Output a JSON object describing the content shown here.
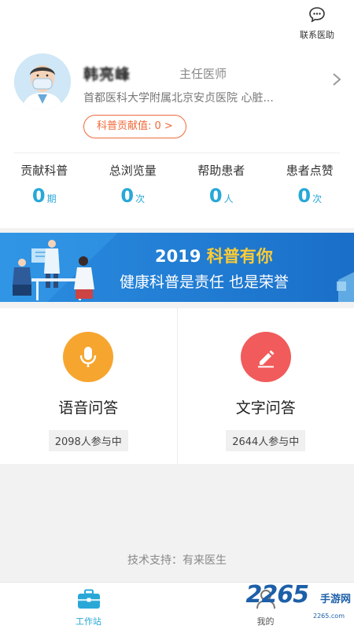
{
  "header": {
    "help_label": "联系医助"
  },
  "profile": {
    "name": "韩亮峰",
    "title": "主任医师",
    "hospital": "首都医科大学附属北京安贞医院   心脏...",
    "contribution_label": "科普贡献值: 0 >"
  },
  "stats": [
    {
      "label": "贡献科普",
      "value": "0",
      "unit": "期"
    },
    {
      "label": "总浏览量",
      "value": "0",
      "unit": "次"
    },
    {
      "label": "帮助患者",
      "value": "0",
      "unit": "人"
    },
    {
      "label": "患者点赞",
      "value": "0",
      "unit": "次"
    }
  ],
  "banner": {
    "year": "2019",
    "highlight": "科普有你",
    "subtitle": "健康科普是责任   也是荣誉"
  },
  "qa": [
    {
      "title": "语音问答",
      "count": "2098人参与中",
      "icon": "microphone-icon",
      "color": "#f6a52f"
    },
    {
      "title": "文字问答",
      "count": "2644人参与中",
      "icon": "pencil-icon",
      "color": "#f15b5b"
    }
  ],
  "footer": {
    "tech_support": "技术支持：有来医生"
  },
  "tabbar": {
    "items": [
      {
        "label": "工作站",
        "active": true
      },
      {
        "label": "我的",
        "active": false
      }
    ]
  },
  "watermark": {
    "brand": "2265",
    "sub": "手游网",
    "url": "2265.com"
  },
  "colors": {
    "accent": "#29a8d8",
    "orange": "#f06a3a",
    "banner_bg": "#1f7fd6"
  }
}
